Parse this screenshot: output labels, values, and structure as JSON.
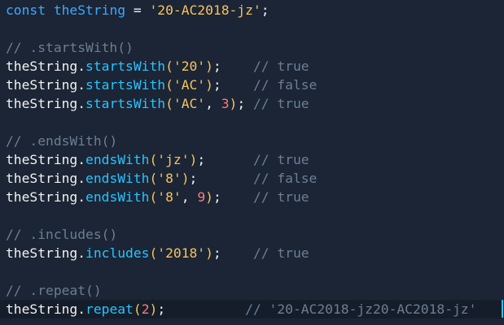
{
  "colors": {
    "background": "#1b2535",
    "active_line": "#151d2a",
    "keyword": "#3fa9ff",
    "identifier": "#f2f2f2",
    "method": "#28c4ff",
    "string": "#f7c35c",
    "number": "#ff7a7a",
    "comment": "#6c7e94",
    "caret": "#28c4ff"
  },
  "code": {
    "lines": [
      {
        "tokens": [
          {
            "t": "const",
            "c": "keyword"
          },
          {
            "t": " ",
            "c": "plain"
          },
          {
            "t": "theString",
            "c": "var"
          },
          {
            "t": " = ",
            "c": "plain"
          },
          {
            "t": "'20-AC2018-jz'",
            "c": "string"
          },
          {
            "t": ";",
            "c": "plain"
          }
        ]
      },
      {
        "tokens": []
      },
      {
        "tokens": [
          {
            "t": "// .startsWith()",
            "c": "comment"
          }
        ]
      },
      {
        "tokens": [
          {
            "t": "theString",
            "c": "plain"
          },
          {
            "t": ".",
            "c": "plain"
          },
          {
            "t": "startsWith",
            "c": "method"
          },
          {
            "t": "(",
            "c": "paren"
          },
          {
            "t": "'20'",
            "c": "string"
          },
          {
            "t": ")",
            "c": "paren"
          },
          {
            "t": ";    ",
            "c": "plain"
          },
          {
            "t": "// true",
            "c": "comment"
          }
        ]
      },
      {
        "tokens": [
          {
            "t": "theString",
            "c": "plain"
          },
          {
            "t": ".",
            "c": "plain"
          },
          {
            "t": "startsWith",
            "c": "method"
          },
          {
            "t": "(",
            "c": "paren"
          },
          {
            "t": "'AC'",
            "c": "string"
          },
          {
            "t": ")",
            "c": "paren"
          },
          {
            "t": ";    ",
            "c": "plain"
          },
          {
            "t": "// false",
            "c": "comment"
          }
        ]
      },
      {
        "tokens": [
          {
            "t": "theString",
            "c": "plain"
          },
          {
            "t": ".",
            "c": "plain"
          },
          {
            "t": "startsWith",
            "c": "method"
          },
          {
            "t": "(",
            "c": "paren"
          },
          {
            "t": "'AC'",
            "c": "string"
          },
          {
            "t": ", ",
            "c": "plain"
          },
          {
            "t": "3",
            "c": "number"
          },
          {
            "t": ")",
            "c": "paren"
          },
          {
            "t": "; ",
            "c": "plain"
          },
          {
            "t": "// true",
            "c": "comment"
          }
        ]
      },
      {
        "tokens": []
      },
      {
        "tokens": [
          {
            "t": "// .endsWith()",
            "c": "comment"
          }
        ]
      },
      {
        "tokens": [
          {
            "t": "theString",
            "c": "plain"
          },
          {
            "t": ".",
            "c": "plain"
          },
          {
            "t": "endsWith",
            "c": "method"
          },
          {
            "t": "(",
            "c": "paren"
          },
          {
            "t": "'jz'",
            "c": "string"
          },
          {
            "t": ")",
            "c": "paren"
          },
          {
            "t": ";      ",
            "c": "plain"
          },
          {
            "t": "// true",
            "c": "comment"
          }
        ]
      },
      {
        "tokens": [
          {
            "t": "theString",
            "c": "plain"
          },
          {
            "t": ".",
            "c": "plain"
          },
          {
            "t": "endsWith",
            "c": "method"
          },
          {
            "t": "(",
            "c": "paren"
          },
          {
            "t": "'8'",
            "c": "string"
          },
          {
            "t": ")",
            "c": "paren"
          },
          {
            "t": ";       ",
            "c": "plain"
          },
          {
            "t": "// false",
            "c": "comment"
          }
        ]
      },
      {
        "tokens": [
          {
            "t": "theString",
            "c": "plain"
          },
          {
            "t": ".",
            "c": "plain"
          },
          {
            "t": "endsWith",
            "c": "method"
          },
          {
            "t": "(",
            "c": "paren"
          },
          {
            "t": "'8'",
            "c": "string"
          },
          {
            "t": ", ",
            "c": "plain"
          },
          {
            "t": "9",
            "c": "number"
          },
          {
            "t": ")",
            "c": "paren"
          },
          {
            "t": ";    ",
            "c": "plain"
          },
          {
            "t": "// true",
            "c": "comment"
          }
        ]
      },
      {
        "tokens": []
      },
      {
        "tokens": [
          {
            "t": "// .includes()",
            "c": "comment"
          }
        ]
      },
      {
        "tokens": [
          {
            "t": "theString",
            "c": "plain"
          },
          {
            "t": ".",
            "c": "plain"
          },
          {
            "t": "includes",
            "c": "method"
          },
          {
            "t": "(",
            "c": "paren"
          },
          {
            "t": "'2018'",
            "c": "string"
          },
          {
            "t": ")",
            "c": "paren"
          },
          {
            "t": ";    ",
            "c": "plain"
          },
          {
            "t": "// true",
            "c": "comment"
          }
        ]
      },
      {
        "tokens": []
      },
      {
        "tokens": [
          {
            "t": "// .repeat()",
            "c": "comment"
          }
        ]
      },
      {
        "active": true,
        "tokens": [
          {
            "t": "theString",
            "c": "plain"
          },
          {
            "t": ".",
            "c": "plain"
          },
          {
            "t": "repeat",
            "c": "method"
          },
          {
            "t": "(",
            "c": "paren"
          },
          {
            "t": "2",
            "c": "number"
          },
          {
            "t": ")",
            "c": "paren"
          },
          {
            "t": ";          ",
            "c": "plain"
          },
          {
            "t": "// '20-AC2018-jz20-AC2018-jz'",
            "c": "comment"
          }
        ]
      }
    ]
  }
}
